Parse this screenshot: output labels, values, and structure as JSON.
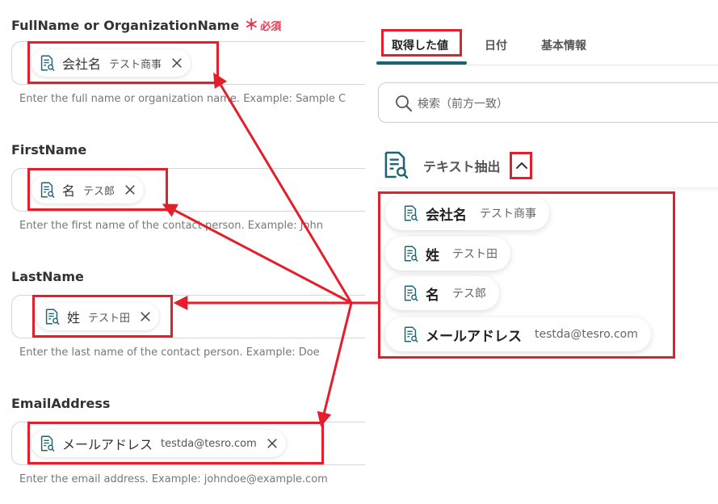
{
  "form": {
    "fields": [
      {
        "label": "FullName or OrganizationName",
        "required_mark": "＊",
        "required_text": "必須",
        "chip_name": "会社名",
        "chip_value": "テスト商事",
        "help": "Enter the full name or organization name. Example: Sample C"
      },
      {
        "label": "FirstName",
        "chip_name": "名",
        "chip_value": "テス郎",
        "help": "Enter the first name of the contact person. Example: John"
      },
      {
        "label": "LastName",
        "chip_name": "姓",
        "chip_value": "テスト田",
        "help": "Enter the last name of the contact person. Example: Doe"
      },
      {
        "label": "EmailAddress",
        "chip_name": "メールアドレス",
        "chip_value": "testda@tesro.com",
        "help": "Enter the email address. Example: johndoe@example.com"
      }
    ]
  },
  "panel": {
    "tabs": [
      {
        "label": "取得した値",
        "active": true
      },
      {
        "label": "日付",
        "active": false
      },
      {
        "label": "基本情報",
        "active": false
      }
    ],
    "search_placeholder": "検索（前方一致）",
    "section_title": "テキスト抽出",
    "items": [
      {
        "name": "会社名",
        "value": "テスト商事"
      },
      {
        "name": "姓",
        "value": "テスト田"
      },
      {
        "name": "名",
        "value": "テス郎"
      },
      {
        "name": "メールアドレス",
        "value": "testda@tesro.com"
      }
    ]
  },
  "colors": {
    "accent": "#1d6470",
    "annotation": "#e41e2a",
    "required": "#e8384f"
  },
  "icons": [
    "text-extract-icon",
    "close-icon",
    "search-icon",
    "chevron-up-icon"
  ]
}
